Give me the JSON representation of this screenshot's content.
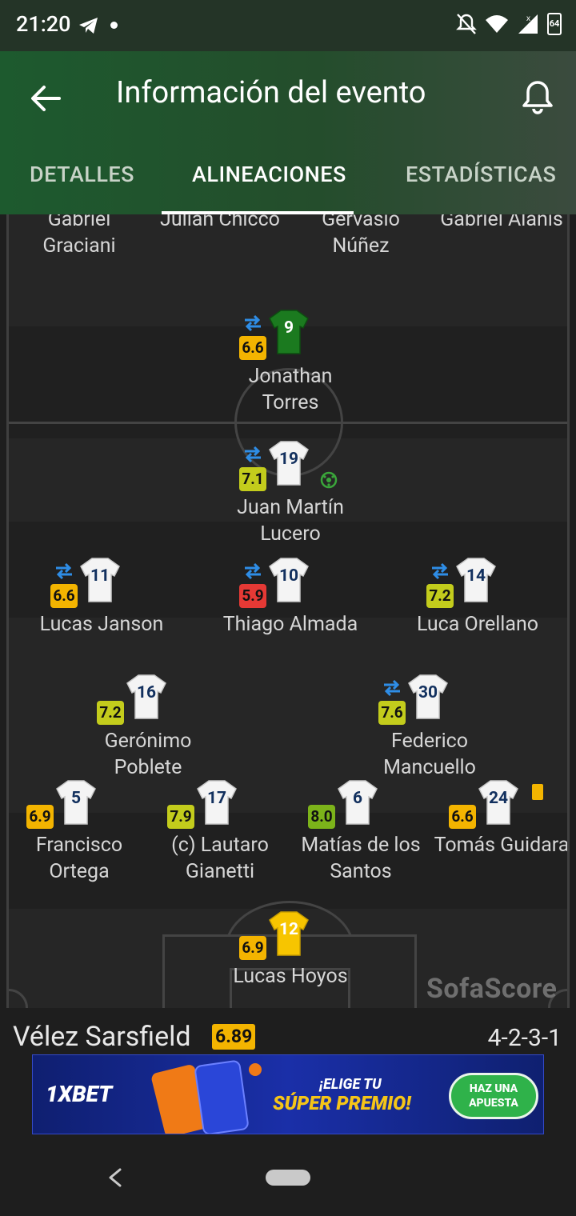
{
  "status_bar": {
    "time": "21:20",
    "battery": "64"
  },
  "app_bar": {
    "title": "Información del evento"
  },
  "tabs": [
    {
      "label": "DETALLES",
      "active": false
    },
    {
      "label": "ALINEACIONES",
      "active": true
    },
    {
      "label": "ESTADÍSTICAS",
      "active": false
    }
  ],
  "opponent_partial": {
    "players": [
      {
        "name_top": "Gabriel",
        "name_bottom": "Graciani"
      },
      {
        "name_top": "Julián Chicco",
        "name_bottom": ""
      },
      {
        "name_top": "Gervasio",
        "name_bottom": "Núñez"
      },
      {
        "name_top": "Gabriel Alanis",
        "name_bottom": ""
      }
    ],
    "forward": {
      "number": "9",
      "rating": "6.6",
      "name": "Jonathan Torres",
      "sub": true
    }
  },
  "lineup": {
    "players": [
      {
        "key": "lucero",
        "number": "19",
        "rating": "7.1",
        "name": "Juan Martín Lucero",
        "sub": true,
        "goal": true
      },
      {
        "key": "janson",
        "number": "11",
        "rating": "6.6",
        "name": "Lucas Janson",
        "sub": true
      },
      {
        "key": "almada",
        "number": "10",
        "rating": "5.9",
        "name": "Thiago Almada",
        "sub": true
      },
      {
        "key": "orellano",
        "number": "14",
        "rating": "7.2",
        "name": "Luca Orellano",
        "sub": true
      },
      {
        "key": "poblete",
        "number": "16",
        "rating": "7.2",
        "name": "Gerónimo Poblete",
        "sub": false
      },
      {
        "key": "mancuello",
        "number": "30",
        "rating": "7.6",
        "name": "Federico Mancuello",
        "sub": true
      },
      {
        "key": "ortega",
        "number": "5",
        "rating": "6.9",
        "name_top": "Francisco",
        "name_bottom": "Ortega"
      },
      {
        "key": "gianetti",
        "number": "17",
        "rating": "7.9",
        "name_top": "(c) Lautaro",
        "name_bottom": "Gianetti"
      },
      {
        "key": "santos",
        "number": "6",
        "rating": "8.0",
        "name_top": "Matías de los",
        "name_bottom": "Santos"
      },
      {
        "key": "guidara",
        "number": "24",
        "rating": "6.6",
        "name_top": "Tomás Guidara",
        "name_bottom": "",
        "yellow_card": true
      },
      {
        "key": "hoyos",
        "number": "12",
        "rating": "6.9",
        "name": "Lucas Hoyos",
        "goalkeeper": true
      }
    ]
  },
  "watermark": "SofaScore",
  "team_footer": {
    "team_name": "Vélez Sarsfield",
    "team_rating": "6.89",
    "formation": "4-2-3-1"
  },
  "ad": {
    "brand": "1XBET",
    "headline_line1": "¡ELIGE TU",
    "headline_line2": "SÚPER PREMIO!",
    "cta_line1": "HAZ UNA",
    "cta_line2": "APUESTA"
  },
  "colors": {
    "gold": "#f3b400",
    "lime": "#c3cc1c",
    "red": "#e53935",
    "green": "#7cb31a",
    "sub_blue": "#2e8de6"
  }
}
